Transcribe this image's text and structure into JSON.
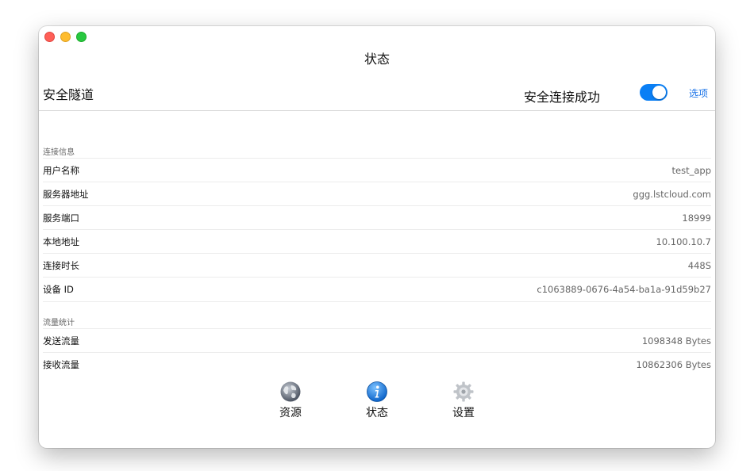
{
  "window": {
    "title": "状态"
  },
  "header": {
    "tunnel_label": "安全隧道",
    "status_text": "安全连接成功",
    "toggle_on": true,
    "options_label": "选项",
    "accent_color": "#0a7ff5"
  },
  "connection": {
    "section_title": "连接信息",
    "rows": [
      {
        "label": "用户名称",
        "value": "test_app"
      },
      {
        "label": "服务器地址",
        "value": "ggg.lstcloud.com"
      },
      {
        "label": "服务端口",
        "value": "18999"
      },
      {
        "label": "本地地址",
        "value": "10.100.10.7"
      },
      {
        "label": "连接时长",
        "value": "448S"
      },
      {
        "label": "设备 ID",
        "value": "c1063889-0676-4a54-ba1a-91d59b27"
      }
    ]
  },
  "traffic": {
    "section_title": "流量统计",
    "rows": [
      {
        "label": "发送流量",
        "value": "1098348 Bytes"
      },
      {
        "label": "接收流量",
        "value": "10862306 Bytes"
      }
    ]
  },
  "tabs": [
    {
      "label": "资源",
      "icon": "globe-icon"
    },
    {
      "label": "状态",
      "icon": "info-icon",
      "active": true
    },
    {
      "label": "设置",
      "icon": "gear-icon"
    }
  ]
}
